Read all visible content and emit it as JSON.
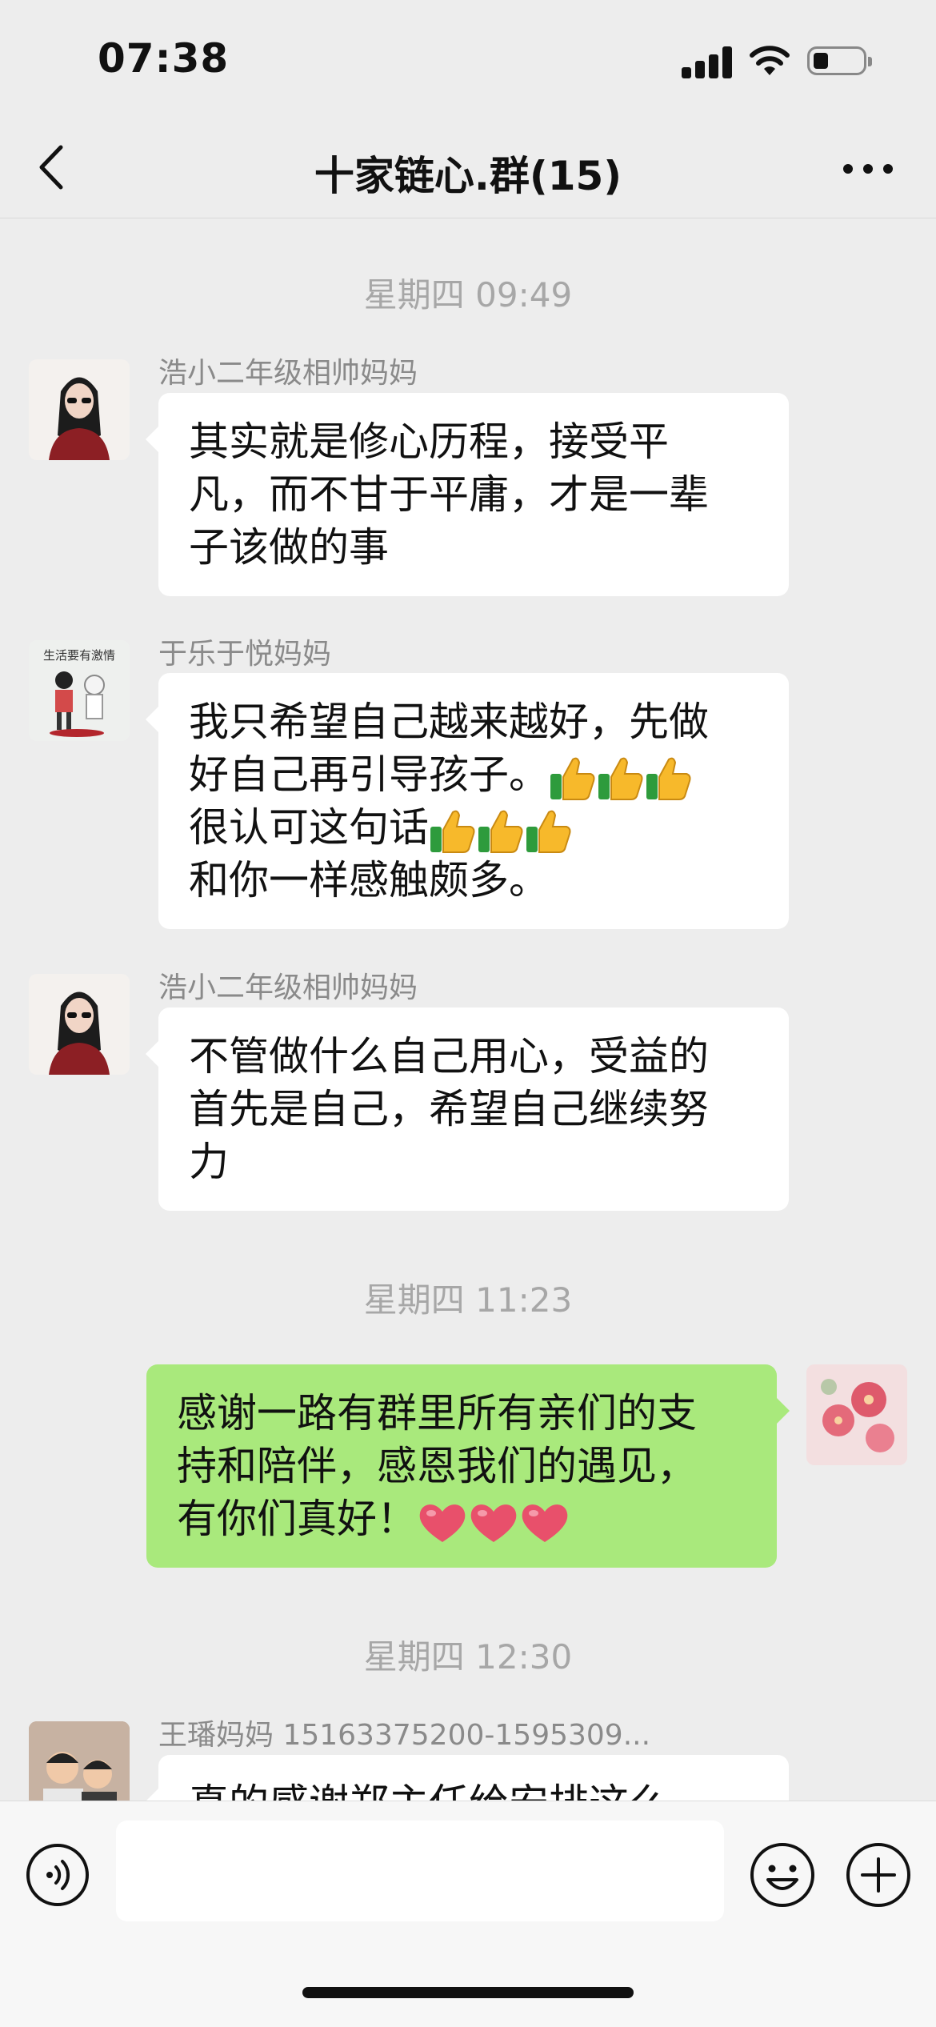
{
  "status_bar": {
    "time": "07:38"
  },
  "header": {
    "title": "十家链心.群(15)"
  },
  "messages": [
    {
      "type": "timestamp",
      "text": "星期四 09:49"
    },
    {
      "type": "incoming",
      "sender": "浩小二年级相帅妈妈",
      "lines": [
        "其实就是修心历程，接受平",
        "凡，而不甘于平庸，才是一辈",
        "子该做的事"
      ]
    },
    {
      "type": "incoming",
      "sender": "于乐于悦妈妈",
      "avatar_caption": "生活要有激情",
      "lines": [
        "我只希望自己越来越好，先做",
        "好自己再引导孩子。",
        "很认可这句话",
        "和你一样感触颇多。"
      ]
    },
    {
      "type": "incoming",
      "sender": "浩小二年级相帅妈妈",
      "lines": [
        "不管做什么自己用心，受益的",
        "首先是自己，希望自己继续努",
        "力"
      ]
    },
    {
      "type": "timestamp",
      "text": "星期四 11:23"
    },
    {
      "type": "outgoing",
      "lines": [
        "感谢一路有群里所有亲们的支",
        "持和陪伴，感恩我们的遇见，",
        "有你们真好！"
      ]
    },
    {
      "type": "timestamp",
      "text": "星期四 12:30"
    },
    {
      "type": "incoming",
      "sender": "王璠妈妈 15163375200-1595309...",
      "lines": [
        "真的感谢郑主任给安排这么"
      ]
    }
  ],
  "colors": {
    "background": "#ededed",
    "outgoing_bubble": "#a9e97c",
    "incoming_bubble": "#ffffff"
  },
  "icons": [
    "back-arrow-icon",
    "more-dots-icon",
    "voice-icon",
    "emoji-icon",
    "plus-icon",
    "thumbs-up-icon",
    "heart-icon"
  ]
}
